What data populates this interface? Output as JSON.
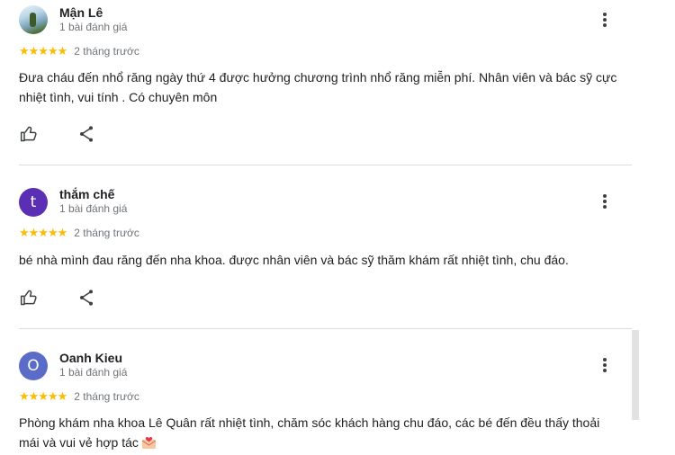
{
  "reviews": [
    {
      "name": "Mận Lê",
      "review_count": "1 bài đánh giá",
      "stars": "★★★★★",
      "time": "2 tháng trước",
      "text": "Đưa cháu đến nhổ răng ngày thứ 4 được hưởng chương trình nhổ răng miễn phí. Nhân viên và bác sỹ cực nhiệt tình, vui tính . Có chuyên môn",
      "avatar": {
        "type": "photo"
      }
    },
    {
      "name": "thắm chế",
      "review_count": "1 bài đánh giá",
      "stars": "★★★★★",
      "time": "2 tháng trước",
      "text": "bé nhà mình đau răng đến nha khoa. được nhân viên và bác sỹ thăm khám rất nhiệt tình, chu đáo.",
      "avatar": {
        "type": "letter",
        "letter": "t",
        "color": "#5b2fb3"
      }
    },
    {
      "name": "Oanh Kieu",
      "review_count": "1 bài đánh giá",
      "stars": "★★★★★",
      "time": "2 tháng trước",
      "text": "Phòng khám nha khoa Lê Quân rất nhiệt tình, chăm sóc khách hàng chu đáo, các bé đến đều thấy thoải mái và vui vẻ hợp tác",
      "emoji": "love-letter-emoji",
      "avatar": {
        "type": "letter",
        "letter": "O",
        "color": "#5a6bc8"
      }
    }
  ],
  "icons": {
    "like": "thumbs-up-icon",
    "share": "share-icon",
    "more": "more-vert-icon"
  },
  "colors": {
    "star": "#fbbc04",
    "secondary_text": "#70757a",
    "divider": "#dadce0"
  }
}
